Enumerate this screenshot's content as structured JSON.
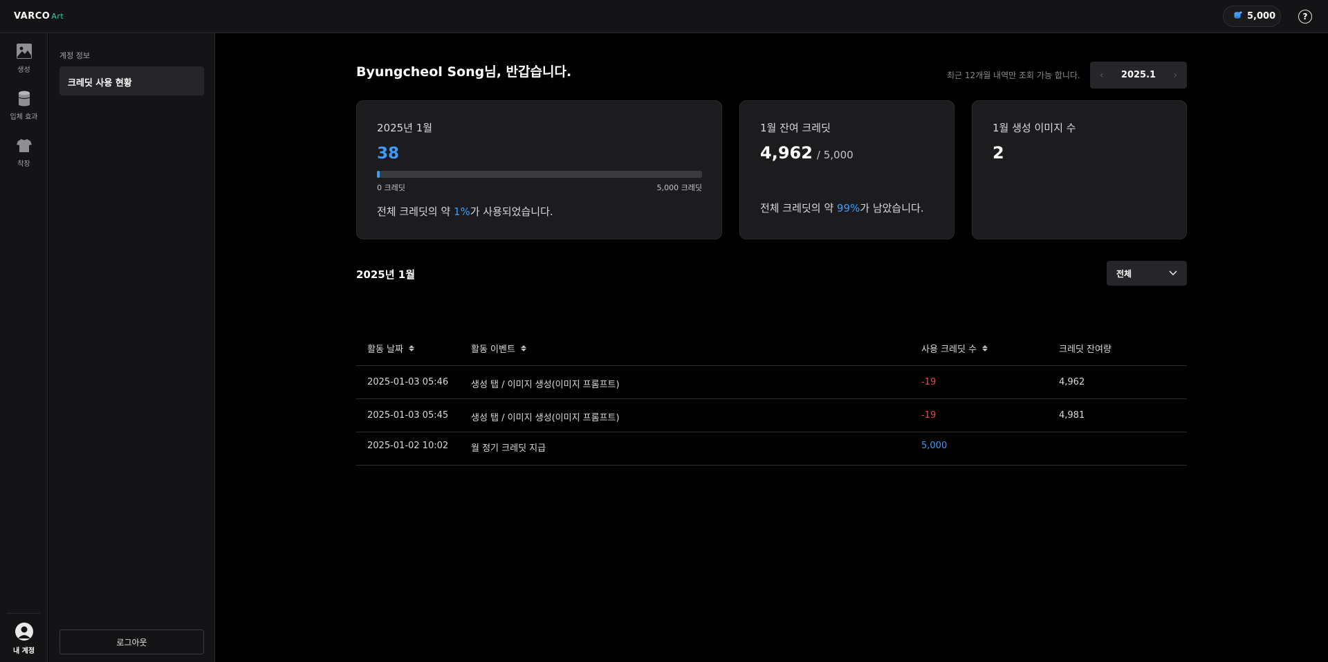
{
  "app": {
    "logo": "VARCO",
    "logo_suffix": "Art"
  },
  "topbar": {
    "credits": "5,000",
    "help_icon": "question-circle-icon",
    "coin_icon": "coin-stack-icon"
  },
  "rail": {
    "items": [
      {
        "label": "생성",
        "icon": "image-icon"
      },
      {
        "label": "입체 효과",
        "icon": "cylinder-icon"
      },
      {
        "label": "착장",
        "icon": "tshirt-icon"
      }
    ],
    "account_label": "내 계정"
  },
  "sidebar": {
    "section_title": "계정 정보",
    "active_item": "크레딧 사용 현황",
    "logout": "로그아웃"
  },
  "main": {
    "greeting": "Byungcheol Song님, 반갑습니다.",
    "notice": "최근 12개월 내역만 조회 가능 합니다.",
    "month": "2025.1"
  },
  "cards": {
    "usage": {
      "title": "2025년 1월",
      "used": "38",
      "used_fraction": 0.0076,
      "min_label": "0 크레딧",
      "max_label": "5,000 크레딧",
      "summary_pre": "전체 크레딧의 약 ",
      "summary_pct": "1%",
      "summary_post": "가 사용되었습니다."
    },
    "remaining": {
      "title": "1월 잔여 크레딧",
      "value": "4,962",
      "total": "/ 5,000",
      "summary_pre": "전체 크레딧의 약 ",
      "summary_pct": "99%",
      "summary_post": "가 남았습니다."
    },
    "images": {
      "title": "1월 생성 이미지 수",
      "value": "2"
    }
  },
  "history": {
    "title": "2025년 1월",
    "filter": "전체",
    "columns": [
      "활동 날짜",
      "활동 이벤트",
      "사용 크레딧 수",
      "크레딧 잔여량"
    ],
    "rows": [
      {
        "date": "2025-01-03 05:46",
        "event": "생성 탭 / 이미지 생성(이미지 프롬프트)",
        "credits": "-19",
        "balance": "4,962"
      },
      {
        "date": "2025-01-03 05:45",
        "event": "생성 탭 / 이미지 생성(이미지 프롬프트)",
        "credits": "-19",
        "balance": "4,981"
      },
      {
        "date": "2025-01-02 10:02",
        "event": "월 정기 크레딧 지급",
        "credits": "5,000",
        "balance": ""
      }
    ]
  },
  "colors": {
    "accent": "#3f9bf5",
    "negative": "#ef4444",
    "brand_green": "#2ad4a6"
  }
}
